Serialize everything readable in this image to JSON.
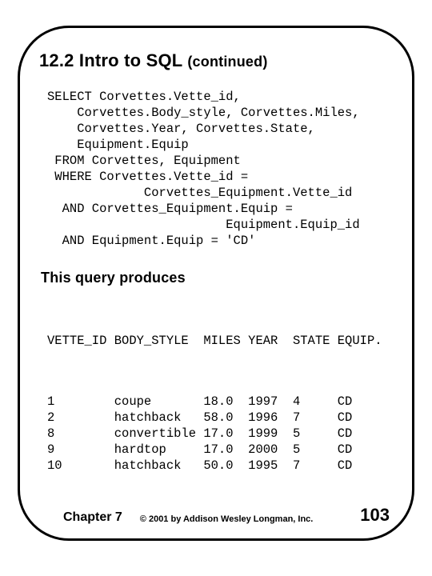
{
  "heading": {
    "main": "12.2 Intro to SQL ",
    "cont": "(continued)"
  },
  "sql_lines": [
    "SELECT Corvettes.Vette_id,",
    "    Corvettes.Body_style, Corvettes.Miles,",
    "    Corvettes.Year, Corvettes.State,",
    "    Equipment.Equip",
    " FROM Corvettes, Equipment",
    " WHERE Corvettes.Vette_id =",
    "             Corvettes_Equipment.Vette_id",
    "  AND Corvettes_Equipment.Equip =",
    "                        Equipment.Equip_id",
    "  AND Equipment.Equip = 'CD'"
  ],
  "produces_label": "This query produces",
  "result_header": "VETTE_ID BODY_STYLE  MILES YEAR  STATE EQUIP.",
  "chart_data": {
    "type": "table",
    "columns": [
      "VETTE_ID",
      "BODY_STYLE",
      "MILES",
      "YEAR",
      "STATE",
      "EQUIP."
    ],
    "rows": [
      {
        "VETTE_ID": "1",
        "BODY_STYLE": "coupe",
        "MILES": "18.0",
        "YEAR": "1997",
        "STATE": "4",
        "EQUIP.": "CD"
      },
      {
        "VETTE_ID": "2",
        "BODY_STYLE": "hatchback",
        "MILES": "58.0",
        "YEAR": "1996",
        "STATE": "7",
        "EQUIP.": "CD"
      },
      {
        "VETTE_ID": "8",
        "BODY_STYLE": "convertible",
        "MILES": "17.0",
        "YEAR": "1999",
        "STATE": "5",
        "EQUIP.": "CD"
      },
      {
        "VETTE_ID": "9",
        "BODY_STYLE": "hardtop",
        "MILES": "17.0",
        "YEAR": "2000",
        "STATE": "5",
        "EQUIP.": "CD"
      },
      {
        "VETTE_ID": "10",
        "BODY_STYLE": "hatchback",
        "MILES": "50.0",
        "YEAR": "1995",
        "STATE": "7",
        "EQUIP.": "CD"
      }
    ]
  },
  "result_rows_fmt": [
    "1        coupe       18.0  1997  4     CD",
    "2        hatchback   58.0  1996  7     CD",
    "8        convertible 17.0  1999  5     CD",
    "9        hardtop     17.0  2000  5     CD",
    "10       hatchback   50.0  1995  7     CD"
  ],
  "footer": {
    "chapter": "Chapter 7",
    "copyright": "© 2001 by Addison Wesley Longman, Inc.",
    "pagenum": "103"
  }
}
